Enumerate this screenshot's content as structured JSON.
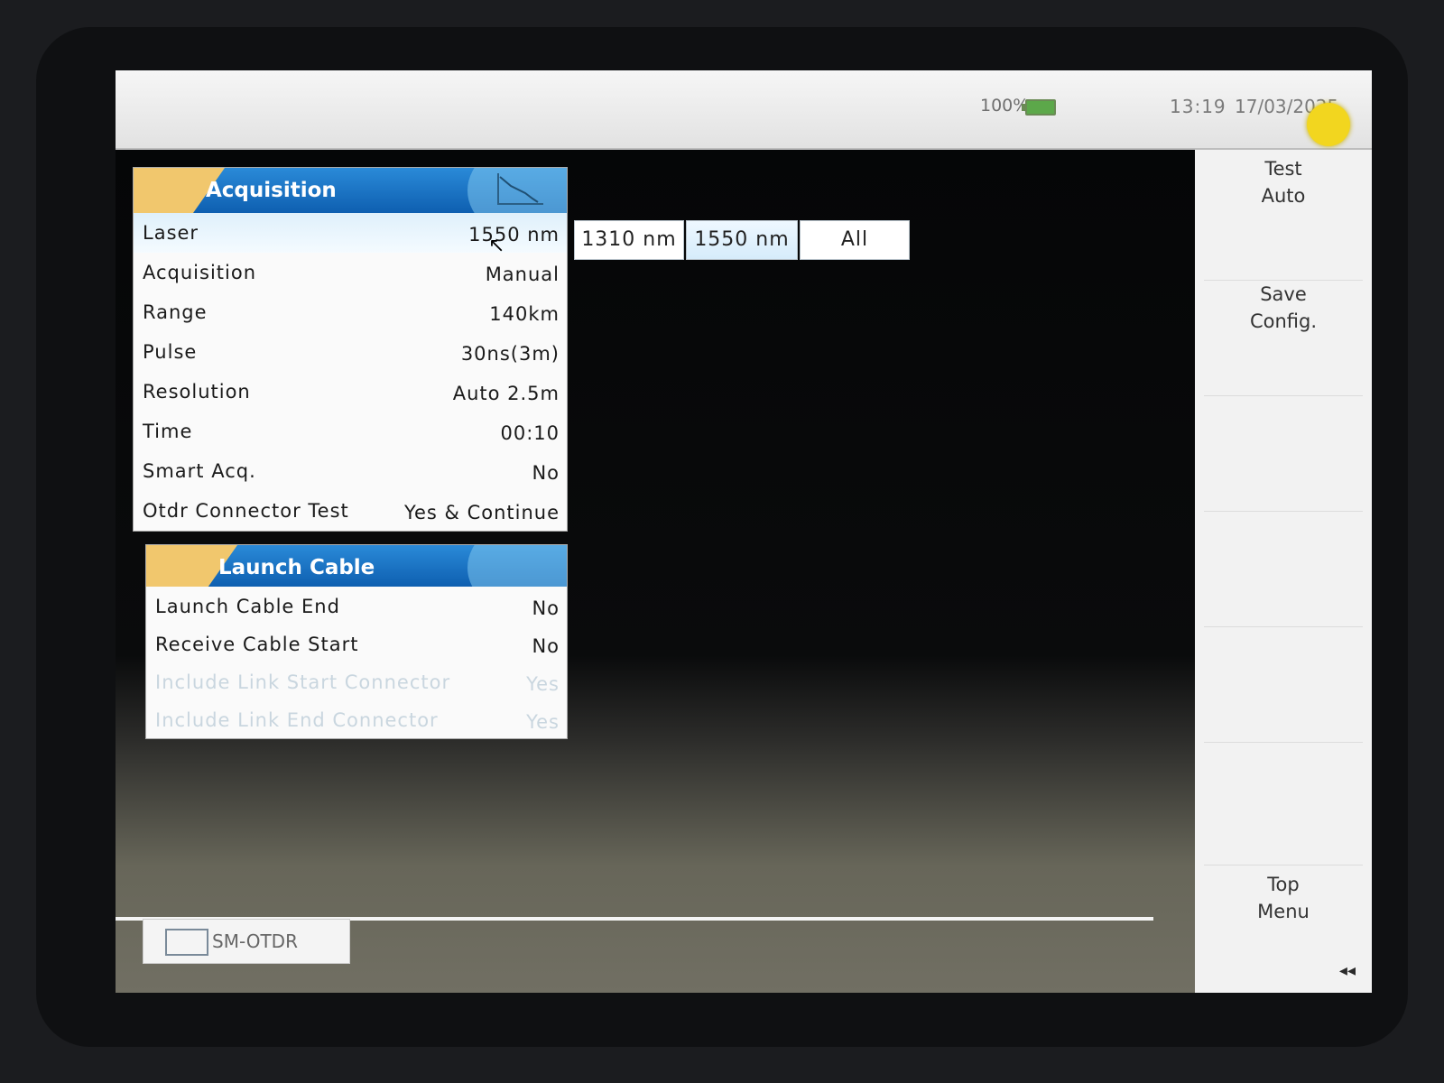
{
  "status_bar": {
    "battery_percent": "100%",
    "time": "13:19",
    "date": "17/03/2025"
  },
  "acquisition_panel": {
    "title": "Acquisition",
    "rows": [
      {
        "label": "Laser",
        "value": "1550 nm"
      },
      {
        "label": "Acquisition",
        "value": "Manual"
      },
      {
        "label": "Range",
        "value": "140km"
      },
      {
        "label": "Pulse",
        "value": "30ns(3m)"
      },
      {
        "label": "Resolution",
        "value": "Auto 2.5m"
      },
      {
        "label": "Time",
        "value": "00:10"
      },
      {
        "label": "Smart Acq.",
        "value": "No"
      },
      {
        "label": "Otdr Connector Test",
        "value": "Yes & Continue"
      }
    ]
  },
  "laser_options": {
    "items": [
      "1310 nm",
      "1550 nm",
      "All"
    ],
    "selected": "1550 nm"
  },
  "launch_cable_panel": {
    "title": "Launch Cable",
    "rows": [
      {
        "label": "Launch Cable End",
        "value": "No"
      },
      {
        "label": "Receive Cable Start",
        "value": "No"
      },
      {
        "label": "Include Link Start Connector",
        "value": "Yes"
      },
      {
        "label": "Include Link End Connector",
        "value": "Yes"
      }
    ]
  },
  "softkeys": {
    "test_auto": [
      "Test",
      "Auto"
    ],
    "save_config": [
      "Save",
      "Config."
    ],
    "top_menu": [
      "Top",
      "Menu"
    ],
    "scroll_glyph": "◂◂"
  },
  "bottom_tab": {
    "label": "SM-OTDR"
  },
  "colors": {
    "header_blue": "#0e5fb0",
    "header_accent": "#f1c76d",
    "battery_green": "#5ca84a",
    "led_yellow": "#f2d61f"
  }
}
